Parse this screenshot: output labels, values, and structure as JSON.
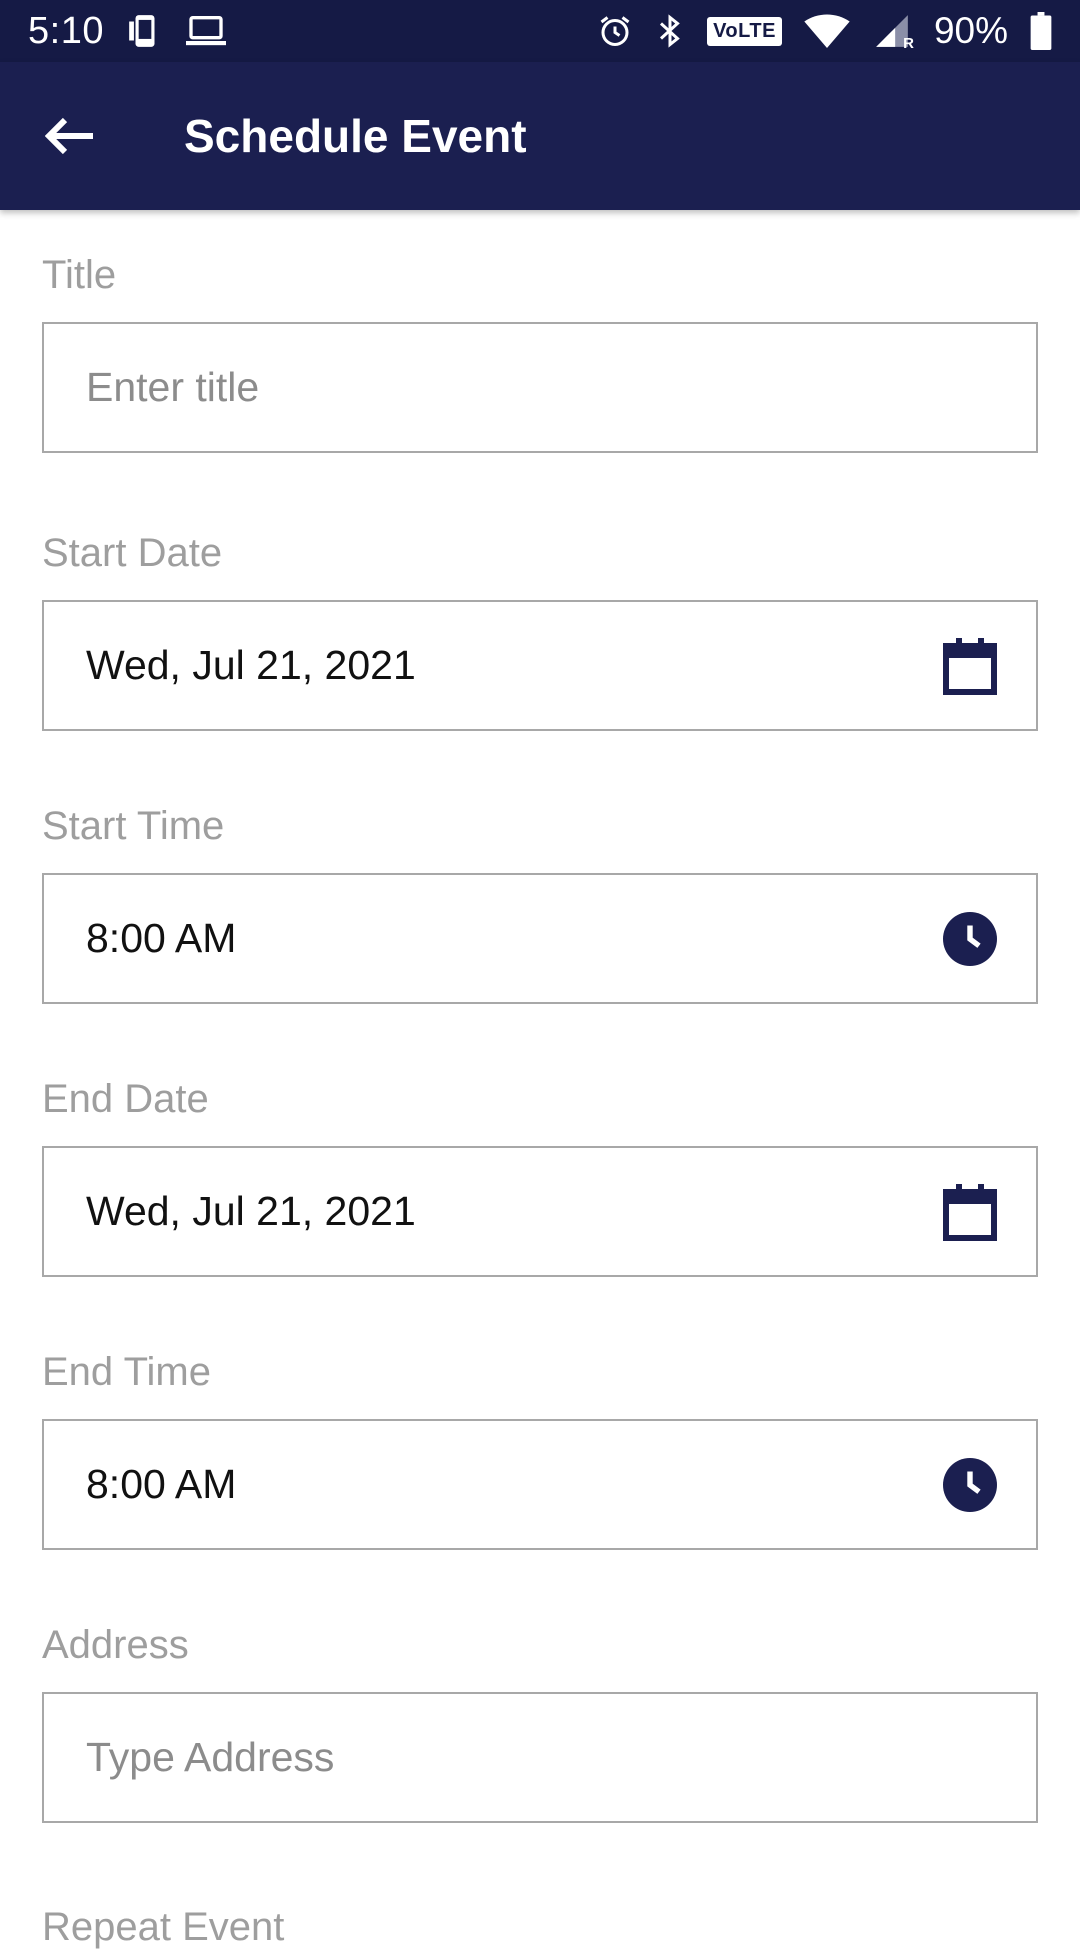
{
  "status_bar": {
    "time": "5:10",
    "battery_percent": "90%",
    "volte_label": "VoLTE",
    "roaming_label": "R",
    "icons": [
      "phone-sync-icon",
      "laptop-icon",
      "alarm-icon",
      "bluetooth-icon",
      "volte-icon",
      "wifi-icon",
      "signal-icon",
      "battery-icon"
    ]
  },
  "app_bar": {
    "title": "Schedule Event",
    "back_icon": "arrow-left-icon"
  },
  "form": {
    "title": {
      "label": "Title",
      "placeholder": "Enter title",
      "value": ""
    },
    "start_date": {
      "label": "Start Date",
      "value": "Wed, Jul 21, 2021",
      "icon": "calendar-icon"
    },
    "start_time": {
      "label": "Start Time",
      "value": "8:00 AM",
      "icon": "clock-icon"
    },
    "end_date": {
      "label": "End Date",
      "value": "Wed, Jul 21, 2021",
      "icon": "calendar-icon"
    },
    "end_time": {
      "label": "End Time",
      "value": "8:00 AM",
      "icon": "clock-icon"
    },
    "address": {
      "label": "Address",
      "placeholder": "Type Address",
      "value": ""
    },
    "repeat_event": {
      "label": "Repeat Event"
    }
  },
  "colors": {
    "status_bar_bg": "#151a45",
    "app_bar_bg": "#1b1f50",
    "accent": "#1b1f50",
    "label_gray": "#9e9e9e",
    "border_gray": "#a8a8a8"
  }
}
